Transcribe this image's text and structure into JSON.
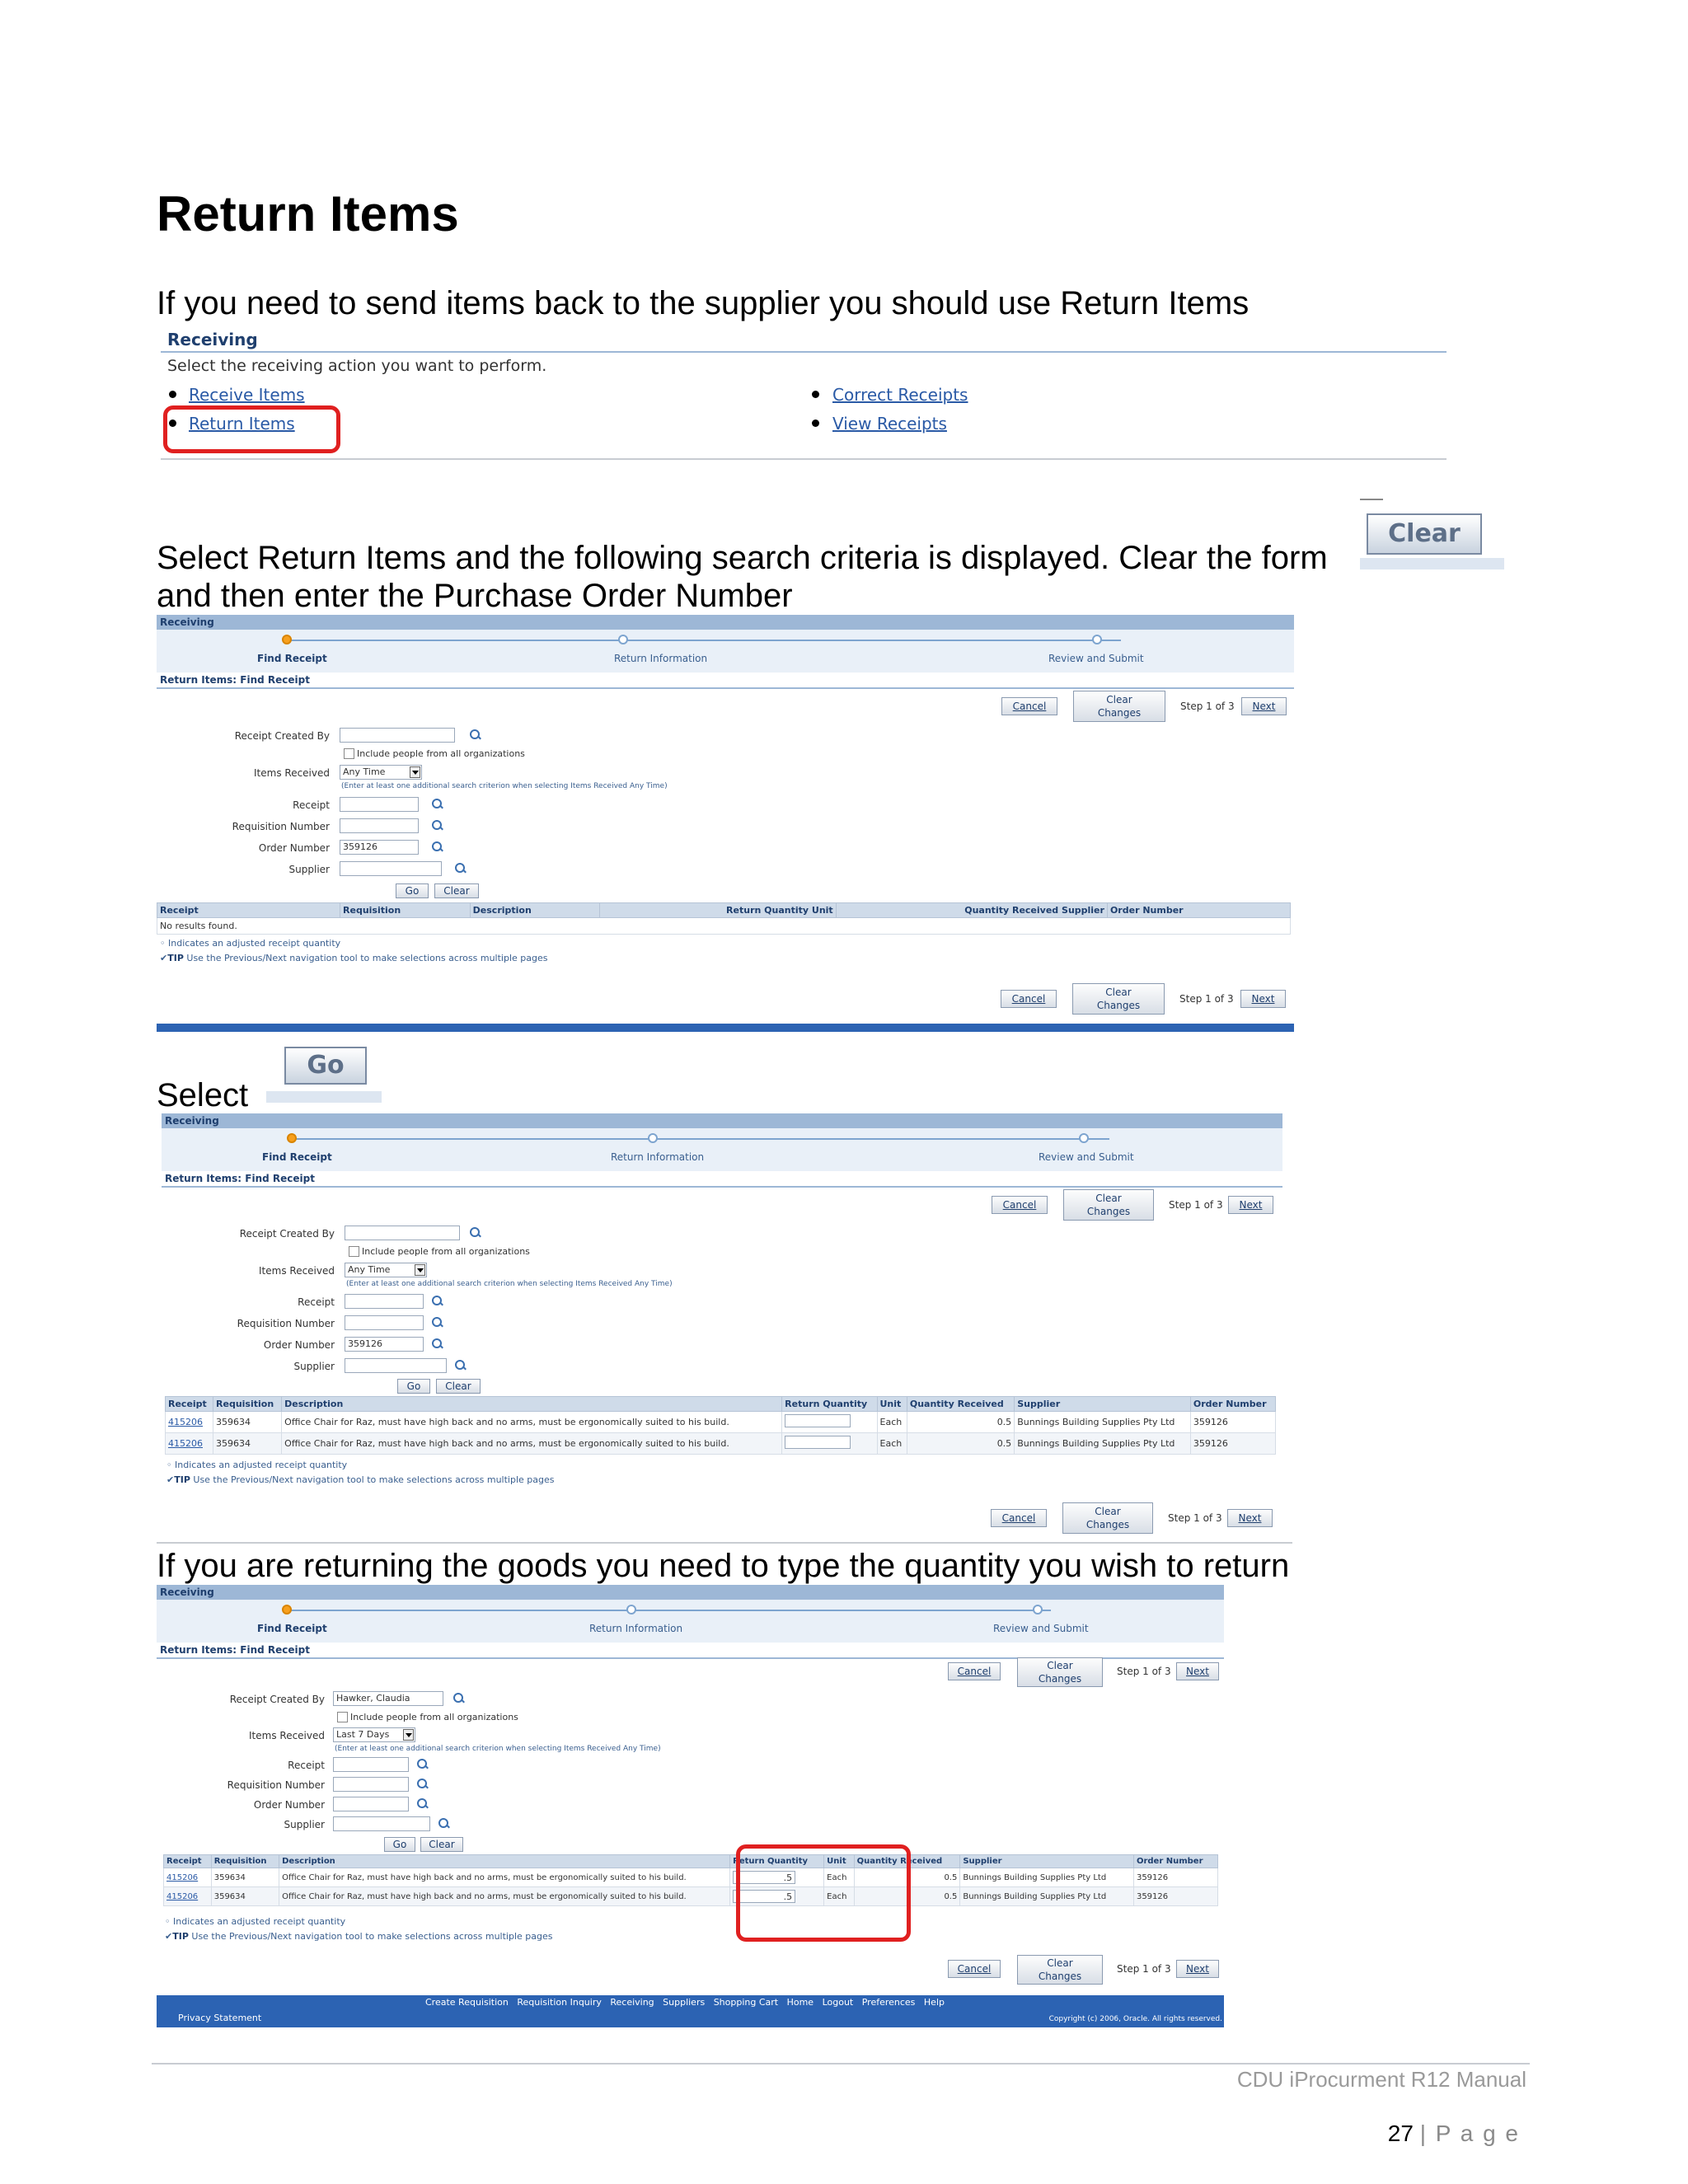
{
  "title": "Return Items",
  "intro": "If you need to send items back to the supplier you should use Return Items",
  "receiving_panel": {
    "heading": "Receiving",
    "instruction": "Select the receiving action you want to perform.",
    "links": [
      "Receive Items",
      "Return Items",
      "Correct Receipts",
      "View Receipts"
    ]
  },
  "clear_button": "Clear",
  "select_text_1": "Select Return Items and the following search criteria is displayed.  Clear the form",
  "select_text_2": "and then enter the Purchase Order Number",
  "go_button": "Go",
  "select_word": "Select",
  "returning_text": "If you are returning the goods you need to type the quantity you wish to return",
  "oracle": {
    "header": "Receiving",
    "train": [
      "Find Receipt",
      "Return Information",
      "Review and Submit"
    ],
    "subheader": "Return Items: Find Receipt",
    "cancel": "Cancel",
    "clear_changes_1": "Clear",
    "clear_changes_2": "Changes",
    "step": "Step 1 of 3",
    "next": "Next",
    "labels": {
      "receipt_created_by": "Receipt Created By",
      "include_people": "Include people from all organizations",
      "items_received": "Items Received",
      "hint": "(Enter at least one additional search criterion when selecting Items Received Any Time)",
      "receipt": "Receipt",
      "requisition_number": "Requisition Number",
      "order_number": "Order Number",
      "supplier": "Supplier"
    },
    "go": "Go",
    "clear": "Clear",
    "any_time": "Any Time",
    "last_7_days": "Last 7 Days",
    "order_value": "359126",
    "created_by_value": "Hawker, Claudia",
    "columns": [
      "Receipt",
      "Requisition",
      "Description",
      "Return Quantity",
      "Unit",
      "Quantity Received",
      "Supplier",
      "Order Number"
    ],
    "no_results": "No results found.",
    "rows": [
      {
        "receipt": "415206",
        "requisition": "359634",
        "description": "Office Chair for Raz, must have high back and no arms, must be ergonomically suited to his build.",
        "return_qty": "",
        "unit": "Each",
        "qty_received": "0.5",
        "supplier": "Bunnings Building Supplies Pty Ltd",
        "order": "359126"
      },
      {
        "receipt": "415206",
        "requisition": "359634",
        "description": "Office Chair for Raz, must have high back and no arms, must be ergonomically suited to his build.",
        "return_qty": "",
        "unit": "Each",
        "qty_received": "0.5",
        "supplier": "Bunnings Building Supplies Pty Ltd",
        "order": "359126"
      }
    ],
    "return_qty_filled": ".5",
    "note": "Indicates an adjusted receipt quantity",
    "tip_label": "TIP",
    "tip": "Use the Previous/Next navigation tool to make selections across multiple pages",
    "footer_links": "Create Requisition   Requisition Inquiry   Receiving   Suppliers   Shopping Cart   Home   Logout   Preferences   Help",
    "privacy": "Privacy Statement",
    "copyright": "Copyright (c) 2006, Oracle. All rights reserved."
  },
  "footer": {
    "manual": "CDU iProcurment R12 Manual",
    "page_number": "27",
    "page_word": "| P a g e"
  }
}
